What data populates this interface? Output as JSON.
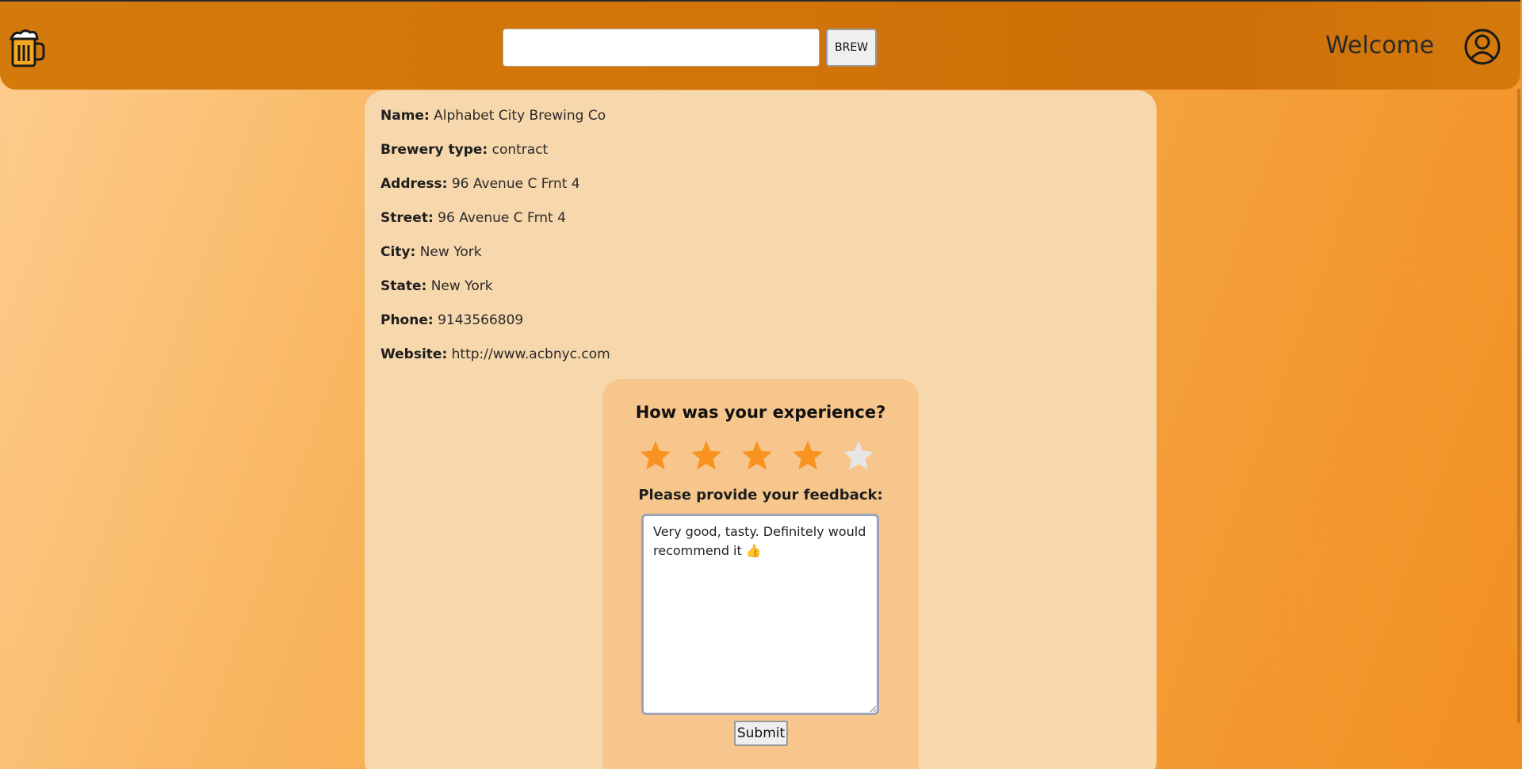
{
  "header": {
    "logo_icon": "beer-mug-icon",
    "search_value": "",
    "search_placeholder": "",
    "brew_label": "BREW",
    "welcome_text": "Welcome",
    "user_icon": "user-circle-icon"
  },
  "brewery": {
    "fields": [
      {
        "label": "Name:",
        "value": "Alphabet City Brewing Co"
      },
      {
        "label": "Brewery type:",
        "value": "contract"
      },
      {
        "label": "Address:",
        "value": "96 Avenue C Frnt 4"
      },
      {
        "label": "Street:",
        "value": "96 Avenue C Frnt 4"
      },
      {
        "label": "City:",
        "value": "New York"
      },
      {
        "label": "State:",
        "value": "New York"
      },
      {
        "label": "Phone:",
        "value": "9143566809"
      },
      {
        "label": "Website:",
        "value": "http://www.acbnyc.com"
      }
    ]
  },
  "feedback": {
    "title": "How was your experience?",
    "rating": 4,
    "max_rating": 5,
    "prompt": "Please provide your feedback:",
    "text": "Very good, tasty. Definitely would recommend it 👍",
    "submit_label": "Submit"
  },
  "colors": {
    "header": "#d17409",
    "card": "#f7d7ac",
    "feedback_card": "#f7c68c",
    "star_filled": "#f7931e",
    "star_empty": "#e6e6e6"
  }
}
